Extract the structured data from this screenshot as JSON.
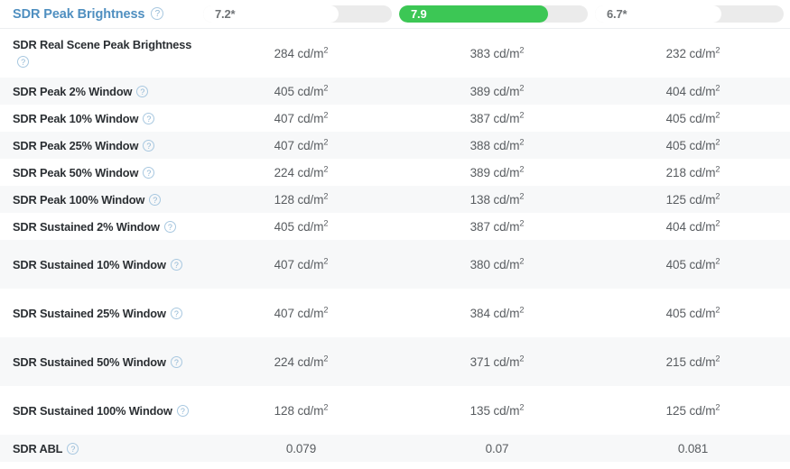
{
  "header": {
    "title": "SDR Peak Brightness",
    "help_icon": "question-mark-icon",
    "scores": [
      {
        "label": "7.2*",
        "value": 7.2,
        "fill_percent": 72,
        "style": "plain"
      },
      {
        "label": "7.9",
        "value": 7.9,
        "fill_percent": 79,
        "style": "green"
      },
      {
        "label": "6.7*",
        "value": 6.7,
        "fill_percent": 67,
        "style": "plain"
      }
    ],
    "colors": {
      "title": "#4f8fc0",
      "green_fill": "#3cc755",
      "track": "#ebebeb",
      "plain_fill": "#ffffff"
    }
  },
  "table": {
    "unit": "cd/m",
    "unit_exponent": "2",
    "rows": [
      {
        "label": "SDR Real Scene Peak Brightness",
        "help_icon": "question-mark-icon",
        "values": [
          "284 cd/m",
          "383 cd/m",
          "232 cd/m"
        ],
        "unit_sup": [
          "2",
          "2",
          "2"
        ],
        "tall": true,
        "alt": false
      },
      {
        "label": "SDR Peak 2% Window",
        "help_icon": "question-mark-icon",
        "values": [
          "405 cd/m",
          "389 cd/m",
          "404 cd/m"
        ],
        "unit_sup": [
          "2",
          "2",
          "2"
        ],
        "tall": false,
        "alt": true
      },
      {
        "label": "SDR Peak 10% Window",
        "help_icon": "question-mark-icon",
        "values": [
          "407 cd/m",
          "387 cd/m",
          "405 cd/m"
        ],
        "unit_sup": [
          "2",
          "2",
          "2"
        ],
        "tall": false,
        "alt": false
      },
      {
        "label": "SDR Peak 25% Window",
        "help_icon": "question-mark-icon",
        "values": [
          "407 cd/m",
          "388 cd/m",
          "405 cd/m"
        ],
        "unit_sup": [
          "2",
          "2",
          "2"
        ],
        "tall": false,
        "alt": true
      },
      {
        "label": "SDR Peak 50% Window",
        "help_icon": "question-mark-icon",
        "values": [
          "224 cd/m",
          "389 cd/m",
          "218 cd/m"
        ],
        "unit_sup": [
          "2",
          "2",
          "2"
        ],
        "tall": false,
        "alt": false
      },
      {
        "label": "SDR Peak 100% Window",
        "help_icon": "question-mark-icon",
        "values": [
          "128 cd/m",
          "138 cd/m",
          "125 cd/m"
        ],
        "unit_sup": [
          "2",
          "2",
          "2"
        ],
        "tall": false,
        "alt": true
      },
      {
        "label": "SDR Sustained 2% Window",
        "help_icon": "question-mark-icon",
        "values": [
          "405 cd/m",
          "387 cd/m",
          "404 cd/m"
        ],
        "unit_sup": [
          "2",
          "2",
          "2"
        ],
        "tall": false,
        "alt": false
      },
      {
        "label": "SDR Sustained 10% Window",
        "help_icon": "question-mark-icon",
        "values": [
          "407 cd/m",
          "380 cd/m",
          "405 cd/m"
        ],
        "unit_sup": [
          "2",
          "2",
          "2"
        ],
        "tall": true,
        "alt": true
      },
      {
        "label": "SDR Sustained 25% Window",
        "help_icon": "question-mark-icon",
        "values": [
          "407 cd/m",
          "384 cd/m",
          "405 cd/m"
        ],
        "unit_sup": [
          "2",
          "2",
          "2"
        ],
        "tall": true,
        "alt": false
      },
      {
        "label": "SDR Sustained 50% Window",
        "help_icon": "question-mark-icon",
        "values": [
          "224 cd/m",
          "371 cd/m",
          "215 cd/m"
        ],
        "unit_sup": [
          "2",
          "2",
          "2"
        ],
        "tall": true,
        "alt": true
      },
      {
        "label": "SDR Sustained 100% Window",
        "help_icon": "question-mark-icon",
        "values": [
          "128 cd/m",
          "135 cd/m",
          "125 cd/m"
        ],
        "unit_sup": [
          "2",
          "2",
          "2"
        ],
        "tall": true,
        "alt": false
      },
      {
        "label": "SDR ABL",
        "help_icon": "question-mark-icon",
        "values": [
          "0.079",
          "0.07",
          "0.081"
        ],
        "unit_sup": [
          "",
          "",
          ""
        ],
        "tall": false,
        "alt": true
      }
    ]
  }
}
